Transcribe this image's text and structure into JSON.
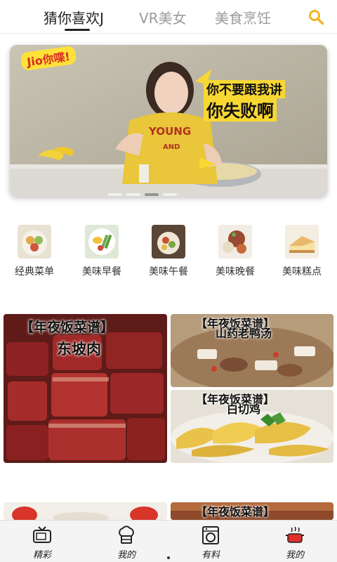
{
  "top_tabs": [
    {
      "label": "猜你喜欢J",
      "active": true
    },
    {
      "label": "VR美女",
      "active": false
    },
    {
      "label": "美食烹饪",
      "active": false
    }
  ],
  "search_icon": "search-icon",
  "accent_color": "#f5b326",
  "hero": {
    "logo_text": "Jio你喋!",
    "caption_line1": "你不要跟我讲",
    "caption_line2": "你失败啊",
    "shirt_text_1": "YOUNG",
    "shirt_text_2": "AND",
    "slide_count": 4,
    "active_slide": 3
  },
  "categories": [
    {
      "label": "经典菜单",
      "icon": "classic-menu-dish"
    },
    {
      "label": "美味早餐",
      "icon": "breakfast-dish"
    },
    {
      "label": "美味午餐",
      "icon": "lunch-dish"
    },
    {
      "label": "美味晚餐",
      "icon": "dinner-dish"
    },
    {
      "label": "美味糕点",
      "icon": "cake-dish"
    }
  ],
  "cards": [
    {
      "title": "【年夜饭菜谱】",
      "subtitle": "东坡肉"
    },
    {
      "title": "【年夜饭菜谱】",
      "subtitle": "山药老鸭汤"
    },
    {
      "title": "【年夜饭菜谱】",
      "subtitle": "白切鸡"
    },
    {
      "title": "",
      "subtitle": ""
    },
    {
      "title": "【年夜饭菜谱】",
      "subtitle": ""
    }
  ],
  "bottom_nav": [
    {
      "label": "精彩",
      "icon": "tv-icon"
    },
    {
      "label": "我的",
      "icon": "chef-hat-icon"
    },
    {
      "label": "有料",
      "icon": "washing-machine-icon"
    },
    {
      "label": "我的",
      "icon": "cooking-pot-icon"
    }
  ]
}
